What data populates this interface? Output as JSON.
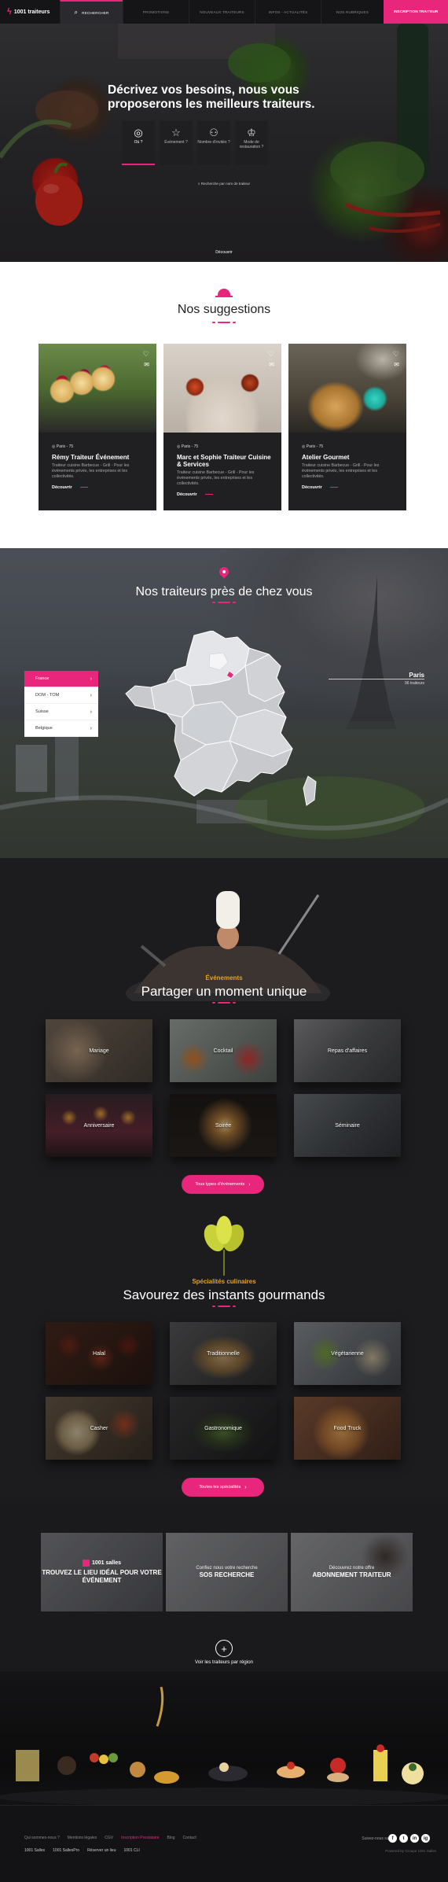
{
  "nav": {
    "logo_text": "1001 traiteurs",
    "items": [
      {
        "label": "Rechercher",
        "active": true
      },
      {
        "label": "Promotions"
      },
      {
        "label": "Nouveaux traiteurs"
      },
      {
        "label": "Infos - Actualités"
      },
      {
        "label": "Nos rubriques"
      }
    ],
    "cta": "Inscription traiteur"
  },
  "hero": {
    "title": "Décrivez vos besoins, nous vous proposerons les meilleurs traiteurs.",
    "steps": [
      {
        "label": "Où ?",
        "icon": "location-icon"
      },
      {
        "label": "Événement ?",
        "icon": "star-icon"
      },
      {
        "label": "Nombre d'invités ?",
        "icon": "people-icon"
      },
      {
        "label": "Mode de restauration ?",
        "icon": "chef-hat-icon"
      }
    ],
    "search_link": "Recherche par nom de traiteur",
    "discover": "Découvrir"
  },
  "suggestions": {
    "title": "Nos suggestions",
    "cards": [
      {
        "location": "Paris - 75",
        "name": "Rémy Traiteur Événement",
        "desc": "Traiteur cuisine Barbecue - Grill - Pour les événements privés, les entreprises et les collectivités.",
        "link": "Découvrir"
      },
      {
        "location": "Paris - 75",
        "name": "Marc et Sophie Traiteur Cuisine & Services",
        "desc": "Traiteur cuisine Barbecue - Grill - Pour les événements privés, les entreprises et les collectivités.",
        "link": "Découvrir"
      },
      {
        "location": "Paris - 75",
        "name": "Atelier Gourmet",
        "desc": "Traiteur cuisine Barbecue - Grill - Pour les événements privés, les entreprises et les collectivités.",
        "link": "Découvrir"
      }
    ]
  },
  "map": {
    "title": "Nos traiteurs près de chez vous",
    "countries": [
      {
        "label": "France",
        "active": true
      },
      {
        "label": "DOM - TOM"
      },
      {
        "label": "Suisse"
      },
      {
        "label": "Belgique"
      }
    ],
    "city": "Paris",
    "city_count": "96 traiteurs"
  },
  "events": {
    "kicker": "Événements",
    "title": "Partager un moment unique",
    "tiles": [
      "Mariage",
      "Cocktail",
      "Repas d'affaires",
      "Anniversaire",
      "Soirée",
      "Séminaire"
    ],
    "button": "Tous types d'événements"
  },
  "specialties": {
    "kicker": "Spécialités culinaires",
    "title": "Savourez des instants gourmands",
    "tiles": [
      "Halal",
      "Traditionnelle",
      "Végétarienne",
      "Casher",
      "Gastronomique",
      "Food Truck"
    ],
    "button": "Toutes les spécialités"
  },
  "promo": [
    {
      "logo": "1001 salles",
      "small": "",
      "big": "TROUVEZ LE LIEU IDÉAL POUR VOTRE ÉVÉNEMENT"
    },
    {
      "logo": "",
      "small": "Confiez nous votre recherche",
      "big": "SOS RECHERCHE"
    },
    {
      "logo": "",
      "small": "Découvrez notre offre",
      "big": "ABONNEMENT TRAITEUR"
    }
  ],
  "region": {
    "label": "Voir les traiteurs par région",
    "icon": "plus-icon"
  },
  "footer": {
    "links": [
      "Qui sommes-nous ?",
      "Mentions légales",
      "CGV",
      "Inscription Prestataire",
      "Blog",
      "Contact"
    ],
    "brands": [
      "1001 Salles",
      "1001 SallesPro",
      "Réserver un lieu",
      "1001 CLI"
    ],
    "follow": "Suivez-nous sur :",
    "socials": [
      "f",
      "t",
      "in",
      "ig"
    ],
    "powered": "Powered by Groupe 1001 Salles"
  },
  "colors": {
    "accent": "#e8267c",
    "dark": "#1c1c1e",
    "gold": "#e0a030"
  }
}
